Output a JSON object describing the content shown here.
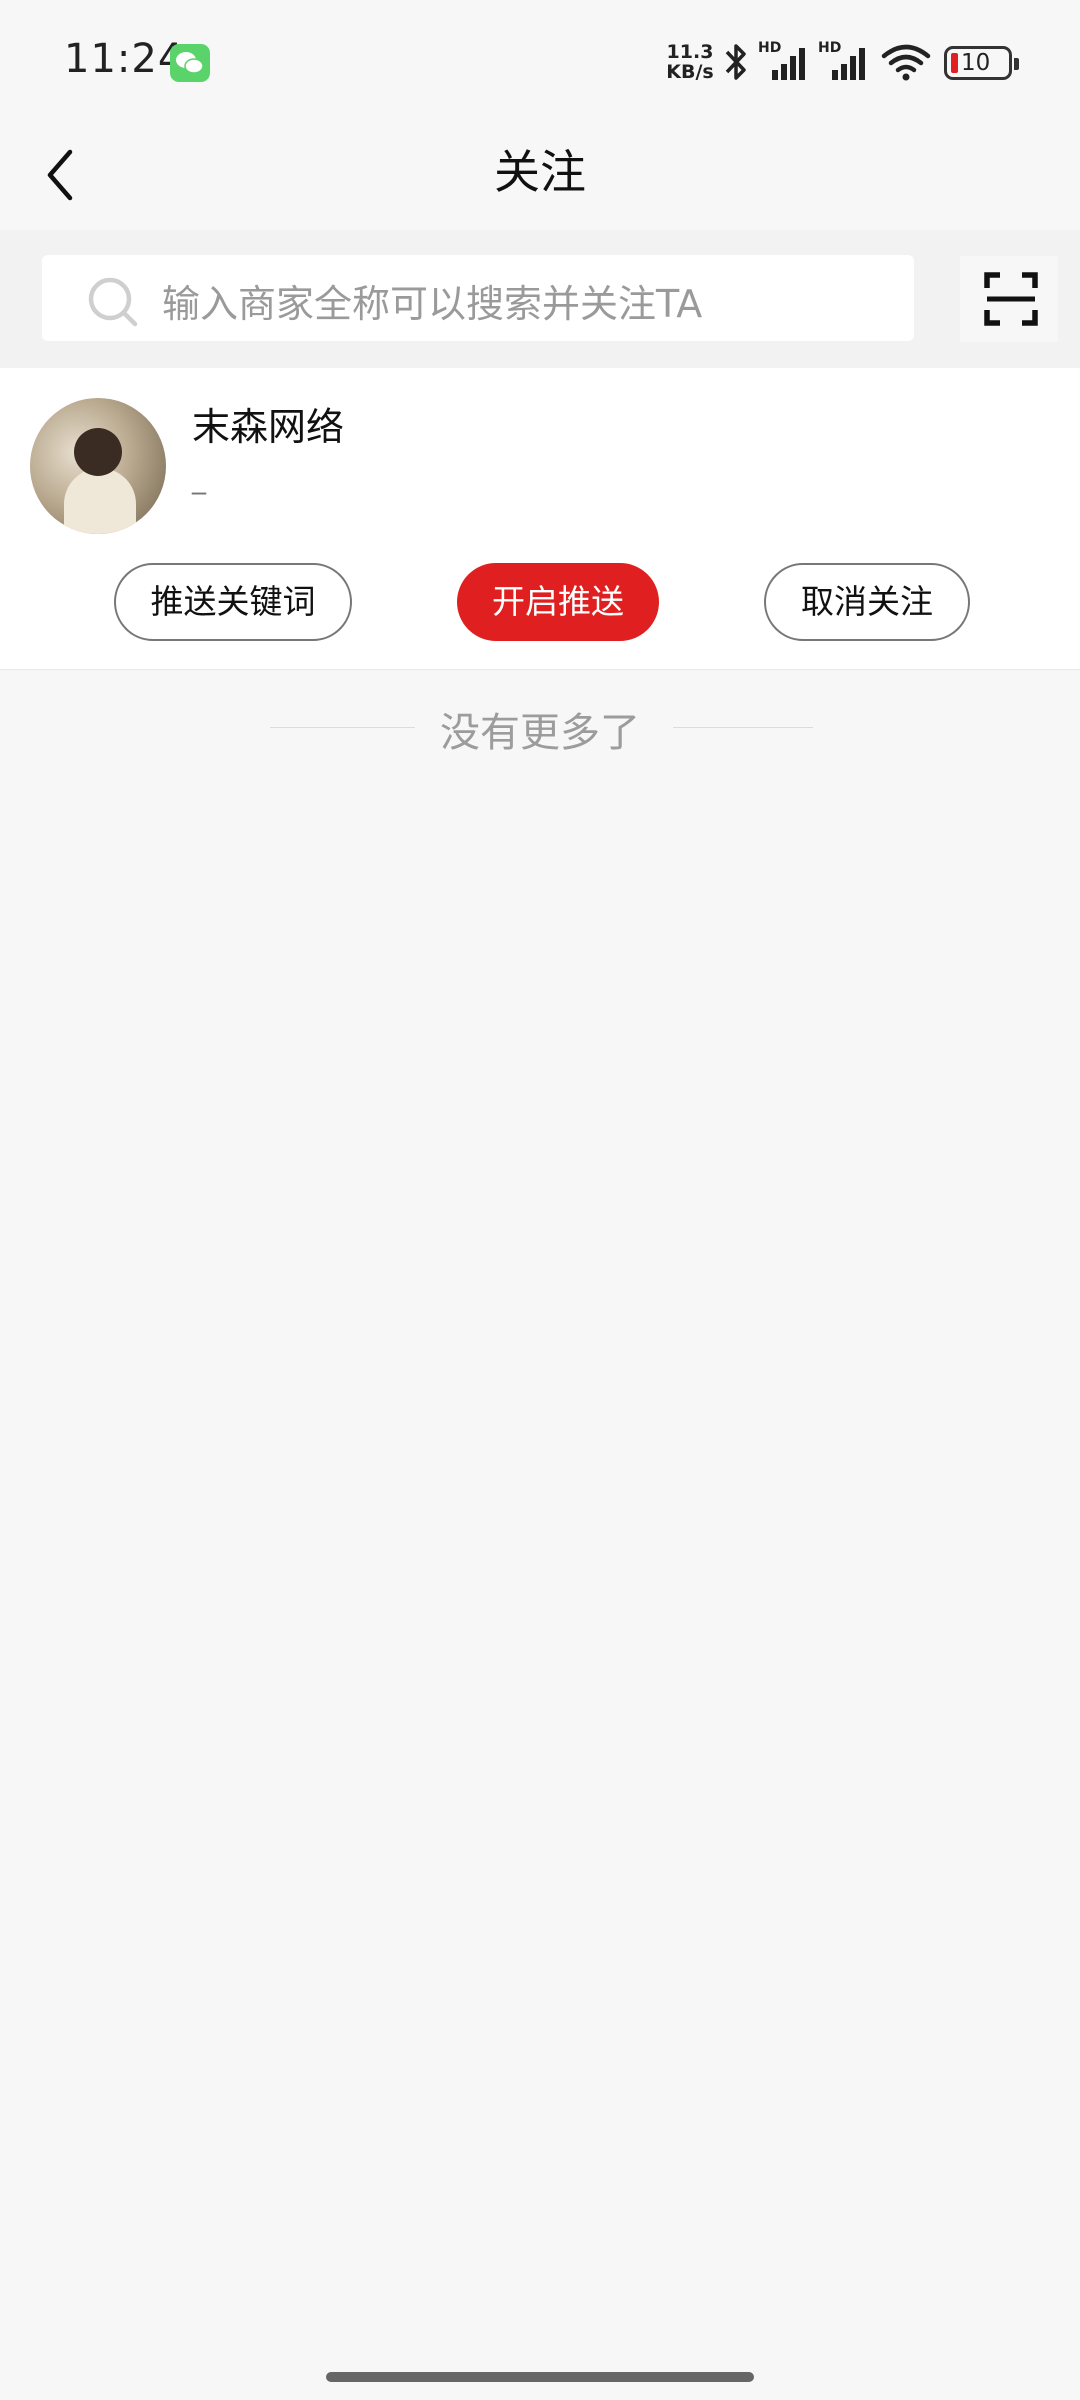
{
  "status_bar": {
    "time": "11:24",
    "net_speed_value": "11.3",
    "net_speed_unit": "KB/s",
    "signal_1_tag": "HD",
    "signal_2_tag": "HD",
    "battery_level": "10",
    "icons": [
      "wechat-icon",
      "bluetooth-icon",
      "signal-icon",
      "signal-icon",
      "wifi-icon",
      "battery-icon"
    ]
  },
  "nav": {
    "title": "关注",
    "back_icon": "chevron-left-icon"
  },
  "search": {
    "placeholder": "输入商家全称可以搜索并关注TA",
    "scan_icon": "scan-icon"
  },
  "following": [
    {
      "name": "末森网络",
      "subtitle": "_",
      "actions": {
        "keywords": "推送关键词",
        "enable_push": "开启推送",
        "unfollow": "取消关注"
      }
    }
  ],
  "list_end_text": "没有更多了",
  "colors": {
    "accent": "#e02020",
    "background": "#f7f7f7",
    "card": "#ffffff"
  }
}
